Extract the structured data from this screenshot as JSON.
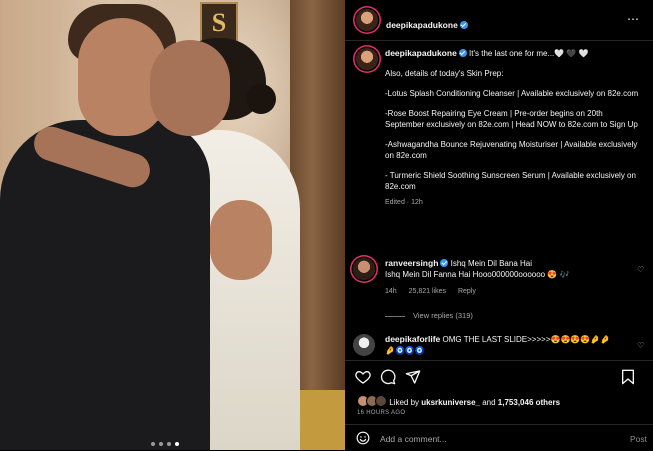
{
  "post": {
    "username": "deepikapadukone",
    "more_icon": "⋯"
  },
  "caption": {
    "username": "deepikapadukone",
    "lines": [
      "It's the last one for me...🤍 🖤 🤍",
      "Also, details of today's Skin Prep:",
      "-Lotus Splash Conditioning Cleanser | Available exclusively on 82e.com",
      "-Rose Boost Repairing Eye Cream | Pre-order begins on 20th September exclusively on 82e.com | Head NOW to 82e.com to Sign Up",
      "-Ashwagandha Bounce Rejuvenating Moisturiser | Available exclusively on 82e.com",
      "- Turmeric Shield Soothing Sunscreen Serum | Available exclusively on 82e.com"
    ],
    "meta": "Edited · 12h"
  },
  "comments": [
    {
      "username": "ranveersingh",
      "text": "Ishq Mein Dil Bana Hai\nIshq Mein Dil Fanna Hai Hooo000000oooooo 😍 🎶",
      "time": "14h",
      "likes": "25,821 likes",
      "reply": "Reply"
    },
    {
      "username": "deepikaforlife",
      "text": "OMG THE LAST SLIDE>>>>>😍😍😍😍🤌🤌",
      "text2": "🤌🧿🧿🧿"
    }
  ],
  "view_replies": "View replies (319)",
  "liked_by": {
    "prefix": "Liked by",
    "user": "uksrkuniverse_",
    "middle": "and",
    "count": "1,753,046 others"
  },
  "timestamp": "16 HOURS AGO",
  "add_comment": {
    "placeholder": "Add a comment...",
    "post": "Post"
  },
  "colors": {
    "background": "#000000",
    "verified": "#3897f0",
    "muted": "#a8a8a8"
  }
}
